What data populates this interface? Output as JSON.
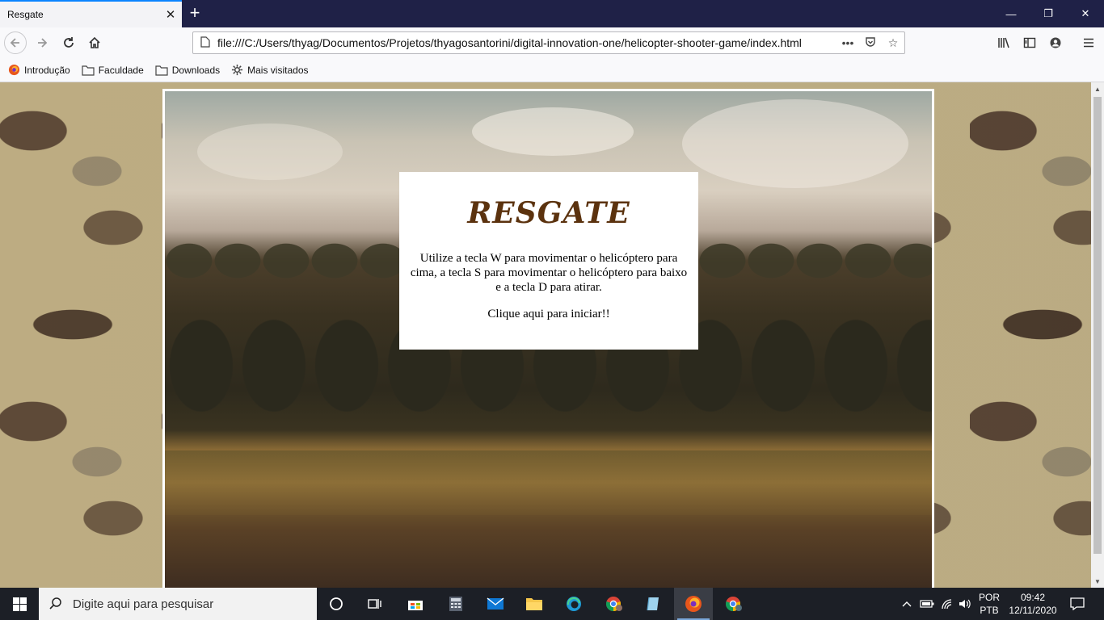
{
  "browser": {
    "tab_title": "Resgate",
    "tab_close": "✕",
    "new_tab": "+",
    "window_controls": {
      "minimize": "—",
      "restore": "❐",
      "close": "✕"
    },
    "url": "file:///C:/Users/thyag/Documentos/Projetos/thyagosantorini/digital-innovation-one/helicopter-shooter-game/index.html",
    "url_more": "•••"
  },
  "bookmarks": [
    {
      "label": "Introdução",
      "icon": "firefox-icon"
    },
    {
      "label": "Faculdade",
      "icon": "folder-icon"
    },
    {
      "label": "Downloads",
      "icon": "folder-icon"
    },
    {
      "label": "Mais visitados",
      "icon": "gear-icon"
    }
  ],
  "game": {
    "title": "RESGATE",
    "instructions": "Utilize a tecla W para movimentar o helicóptero para cima, a tecla S para movimentar o helicóptero para baixo e a tecla D para atirar.",
    "start_link": "Clique aqui para iniciar!!"
  },
  "taskbar": {
    "search_placeholder": "Digite aqui para pesquisar",
    "language_top": "POR",
    "language_bottom": "PTB",
    "time": "09:42",
    "date": "12/11/2020"
  },
  "colors": {
    "tab_accent": "#0a84ff",
    "title_bar": "#1f2147",
    "game_title": "#5b320e",
    "taskbar": "#1c1f26"
  }
}
